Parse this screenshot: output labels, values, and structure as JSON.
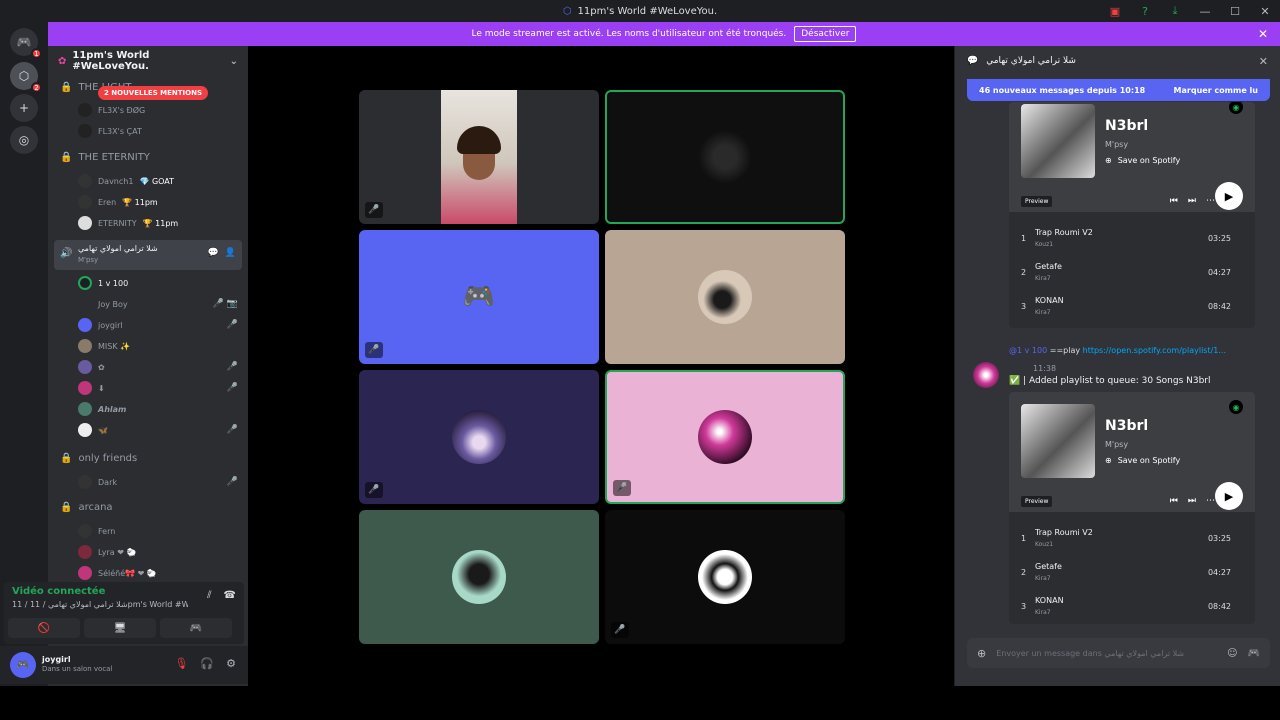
{
  "window": {
    "title": "11pm's World #WeLoveYou.",
    "controls": [
      "—",
      "☐",
      "✕"
    ]
  },
  "banner": {
    "text": "Le mode streamer est activé. Les noms d'utilisateur ont été tronqués.",
    "button": "Désactiver",
    "close": "✕"
  },
  "guilds": {
    "badges": [
      "1",
      "2"
    ]
  },
  "server": {
    "name": "11pm's World #WeLoveYou."
  },
  "sidebar": {
    "mentions": "2 NOUVELLES MENTIONS",
    "cat1": "THE LIGHT",
    "cat1_users": [
      "FL3X's ÐØG",
      "FL3X's ÇAT"
    ],
    "cat2": "THE ETERNITY",
    "cat2_users": [
      {
        "name": "Davnch1",
        "tag": "💎 GOAT"
      },
      {
        "name": "Eren",
        "tag": "🏆 11pm"
      },
      {
        "name": "ETERNITY",
        "tag": "🏆 11pm"
      }
    ],
    "current": {
      "name": "شلا ترامي امولاي تهامي",
      "sub": "M'psy"
    },
    "voice_users": [
      {
        "name": "1 v 100",
        "muted": ""
      },
      {
        "name": "Joy Boy",
        "muted": "🎤 📷"
      },
      {
        "name": "joygirl",
        "muted": "🎤"
      },
      {
        "name": "MISK ✨",
        "muted": ""
      },
      {
        "name": "✿",
        "muted": "🎤"
      },
      {
        "name": "⬇",
        "muted": "🎤"
      },
      {
        "name": "Ahlam",
        "muted": ""
      },
      {
        "name": "🦋",
        "muted": "🎤"
      }
    ],
    "cat3": "only friends",
    "cat3_users": [
      {
        "name": "Dark",
        "muted": "🎤"
      }
    ],
    "cat4": "arcana",
    "cat4_users": [
      "Fern",
      "Lyra ❤ 🐑",
      "Séléñé🎀 ❤ 🐑"
    ]
  },
  "voicebar": {
    "status": "Vidéo connectée",
    "channel": "11 / شلا ترامي امولاي تهامي / 11pm's World #WeLove...",
    "buttons": [
      "🚫",
      "🖥",
      "🎮"
    ]
  },
  "user": {
    "name": "joygirl",
    "status": "Dans un salon vocal"
  },
  "tiles": [
    {
      "muted": "🎤"
    },
    {
      "muted": ""
    },
    {
      "muted": "🎤"
    },
    {
      "muted": ""
    },
    {
      "muted": "🎤"
    },
    {
      "muted": "🎤"
    },
    {
      "muted": ""
    },
    {
      "muted": "🎤"
    }
  ],
  "chat": {
    "channel": "شلا ترامي امولاي تهامي",
    "new_messages": "46 nouveaux messages depuis 10:18",
    "mark_read": "Marquer comme lu",
    "embed": {
      "title": "N3brl",
      "artist": "M'psy",
      "save": "Save on Spotify",
      "preview": "Preview",
      "tracks": [
        {
          "n": "1",
          "title": "Trap Roumi V2",
          "artist": "Kouz1",
          "dur": "03:25"
        },
        {
          "n": "2",
          "title": "Getafe",
          "artist": "Kira7",
          "dur": "04:27"
        },
        {
          "n": "3",
          "title": "KONAN",
          "artist": "Kira7",
          "dur": "08:42"
        }
      ]
    },
    "reply": {
      "user": "@1 v 100",
      "cmd": "==play",
      "link": "https://open.spotify.com/playlist/1..."
    },
    "bot_time": "11:38",
    "bot_msg": "| Added playlist to queue: 30 Songs N3brl",
    "composer_placeholder": "Envoyer un message dans شلا ترامي امولاي تهامي"
  }
}
